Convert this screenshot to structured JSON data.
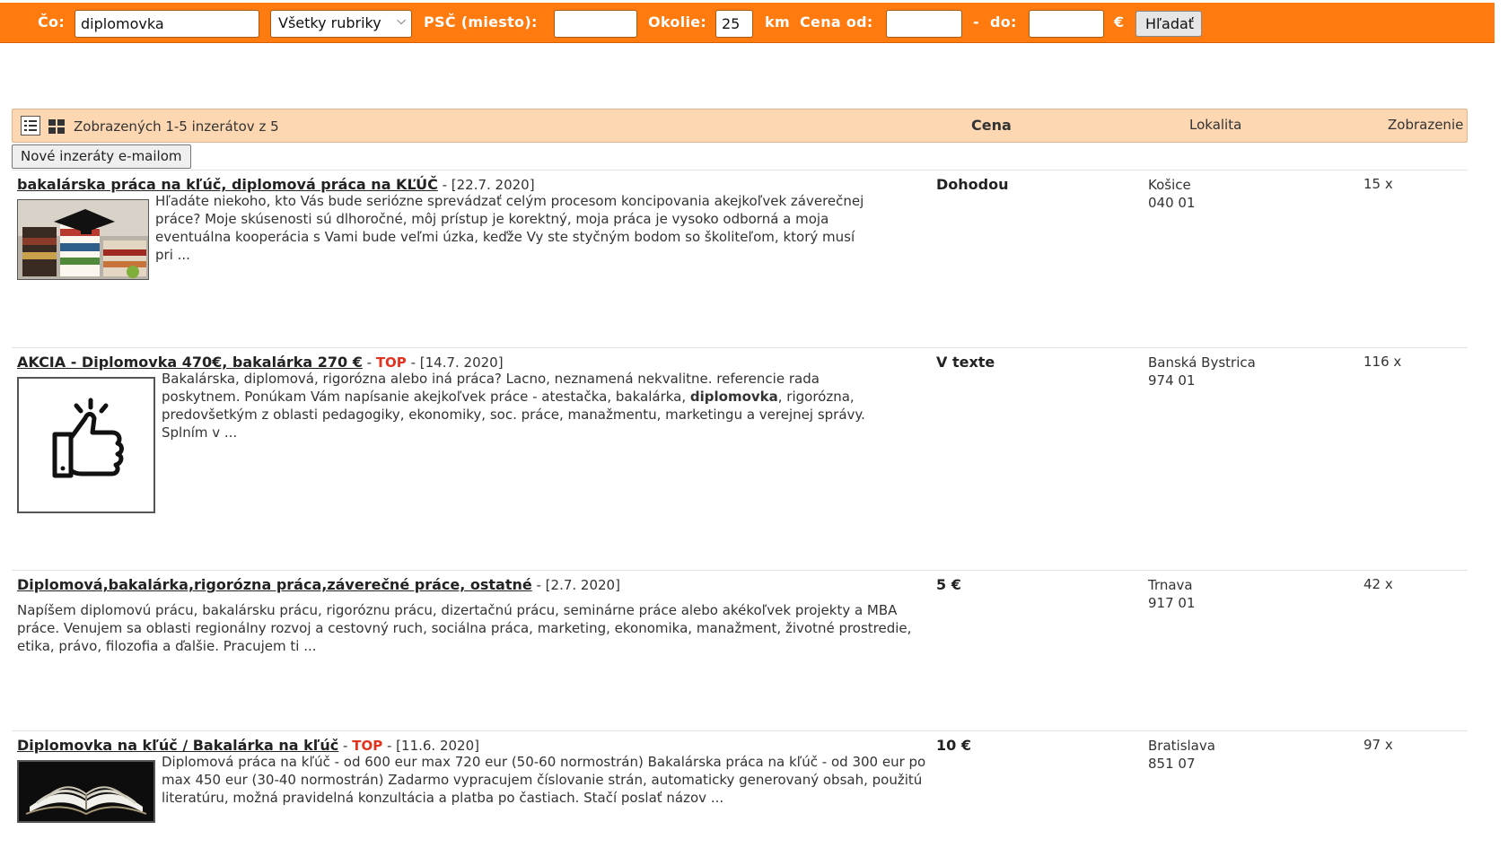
{
  "search": {
    "what_label": "Čo:",
    "what_value": "diplomovka",
    "category_value": "Všetky rubriky",
    "psc_label": "PSČ (miesto):",
    "psc_value": "",
    "radius_label": "Okolie:",
    "radius_value": "25",
    "km_label": "km",
    "price_from_label": "Cena od:",
    "price_from_value": "",
    "dash_label": "-",
    "price_to_label": "do:",
    "price_to_value": "",
    "currency_label": "€",
    "submit_label": "Hľadať"
  },
  "list_header": {
    "count_text": "Zobrazených 1-5 inzerátov z 5",
    "col_price": "Cena",
    "col_location": "Lokalita",
    "col_views": "Zobrazenie"
  },
  "email_button_label": "Nové inzeráty e-mailom",
  "listings": [
    {
      "title": "bakalárska práca na kľúč, diplomová práca na KĽÚČ",
      "sep1": " - ",
      "top": "",
      "sep2": "",
      "date": "[22.7. 2020]",
      "description": "Hľadáte niekoho, kto Vás bude seriózne sprevádzať celým procesom koncipovania akejkoľvek záverečnej práce? Moje skúsenosti sú dlhoročné, môj prístup je korektný, moja práca je vysoko odborná a moja eventuálna kooperácia s Vami bude veľmi úzka, keďže Vy ste styčným bodom so školiteľom, ktorý musí pri ...",
      "price": "Dohodou",
      "city": "Košice",
      "zip": "040 01",
      "views": "15 x"
    },
    {
      "title": "AKCIA - Diplomovka 470€, bakalárka 270 €",
      "sep1": " - ",
      "top": "TOP",
      "sep2": " - ",
      "date": "[14.7. 2020]",
      "desc_before": "Bakalárska, diplomová, rigorózna alebo iná práca? Lacno, neznamená nekvalitne. referencie rada poskytnem. Ponúkam Vám napísanie akejkoľvek práce - atestačka, bakalárka, ",
      "desc_bold": "diplomovka",
      "desc_after": ", rigorózna, predovšetkým z oblasti pedagogiky, ekonomiky, soc. práce, manažmentu, marketingu a verejnej správy. Splním v ...",
      "price": "V texte",
      "city": "Banská Bystrica",
      "zip": "974 01",
      "views": "116 x"
    },
    {
      "title": "Diplomová,bakalárka,rigorózna práca,záverečné práce, ostatné",
      "sep1": " - ",
      "top": "",
      "sep2": "",
      "date": "[2.7. 2020]",
      "description": "Napíšem diplomovú prácu, bakalársku prácu, rigoróznu prácu, dizertačnú prácu, seminárne práce alebo akékoľvek projekty a MBA práce. Venujem sa oblasti regionálny rozvoj a cestovný ruch, sociálna práca, marketing, ekonomika, manažment, životné prostredie, etika, právo, filozofia a ďalšie. Pracujem ti ...",
      "price": "5 €",
      "city": "Trnava",
      "zip": "917 01",
      "views": "42 x"
    },
    {
      "title": "Diplomovka na kľúč / Bakalárka na kľúč",
      "sep1": " - ",
      "top": "TOP",
      "sep2": " - ",
      "date": "[11.6. 2020]",
      "description": "Diplomová práca na kľúč - od 600 eur max 720 eur (50-60 normostrán) Bakalárska práca na kľúč - od 300 eur po max 450 eur (30-40 normostrán) Zadarmo vypracujem číslovanie strán, automaticky generovaný obsah, použitú literatúru, možná pravidelná konzultácia a platba po častiach. Stačí poslať názov ...",
      "price": "10 €",
      "city": "Bratislava",
      "zip": "851 07",
      "views": "97 x"
    }
  ],
  "colors": {
    "topbar": "#ff7a0f",
    "header_bar": "#fdd6b2",
    "top_tag": "#e3331e"
  },
  "icons": [
    "list-view-icon",
    "grid-view-icon",
    "chevron-down-icon",
    "thumbs-up-icon"
  ]
}
